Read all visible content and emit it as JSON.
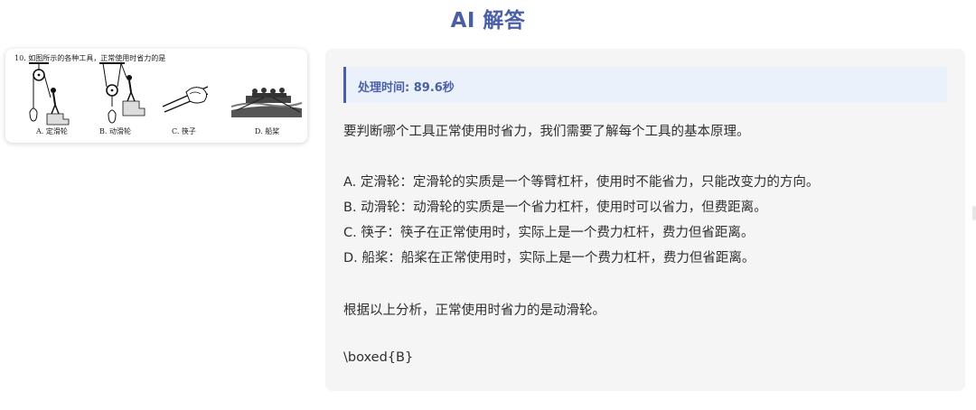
{
  "header": {
    "title": "AI 解答"
  },
  "question": {
    "text": "10. 如图所示的各种工具，正常使用时省力的是",
    "options": [
      "A. 定滑轮",
      "B. 动滑轮",
      "C. 筷子",
      "D. 船桨"
    ]
  },
  "answer": {
    "processing_time": "处理时间: 89.6秒",
    "intro": "要判断哪个工具正常使用时省力，我们需要了解每个工具的基本原理。",
    "items": [
      "A. 定滑轮：定滑轮的实质是一个等臂杠杆，使用时不能省力，只能改变力的方向。",
      "B. 动滑轮：动滑轮的实质是一个省力杠杆，使用时可以省力，但费距离。",
      "C. 筷子：筷子在正常使用时，实际上是一个费力杠杆，费力但省距离。",
      "D. 船桨：船桨在正常使用时，实际上是一个费力杠杆，费力但省距离。"
    ],
    "conclusion": "根据以上分析，正常使用时省力的是动滑轮。",
    "boxed": "\\boxed{B}"
  },
  "colors": {
    "accent": "#4a5fa6",
    "panel": "#f5f5f5",
    "time_bg": "#ebf1fa"
  }
}
